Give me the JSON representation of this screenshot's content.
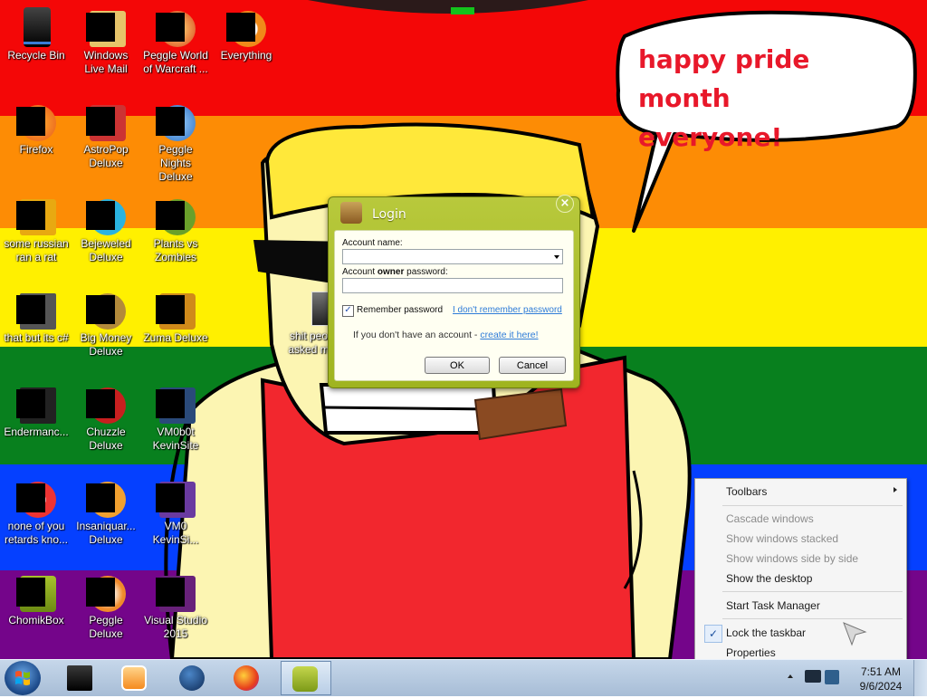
{
  "wallpaper": {
    "colors": [
      "#f40707",
      "#fd8c05",
      "#fff000",
      "#08801e",
      "#0540ff",
      "#74058a"
    ],
    "speech_bubble": [
      "happy pride month",
      "everyone!"
    ]
  },
  "desktop": {
    "icons": [
      {
        "label": "Recycle Bin",
        "icon": "recycle-bin-icon"
      },
      {
        "label": "Windows Live Mail",
        "icon": "mail-icon"
      },
      {
        "label": "Peggle World of Warcraft ...",
        "icon": "peggle-icon"
      },
      {
        "label": "Everything",
        "icon": "everything-search-icon"
      },
      {
        "label": "Firefox",
        "icon": "firefox-icon"
      },
      {
        "label": "AstroPop Deluxe",
        "icon": "astropop-icon"
      },
      {
        "label": "Peggle Nights Deluxe",
        "icon": "peggle-nights-icon"
      },
      {
        "label": "some russian ran a rat",
        "icon": "ie-icon"
      },
      {
        "label": "Bejeweled Deluxe",
        "icon": "bejeweled-icon"
      },
      {
        "label": "Plants vs Zombies",
        "icon": "plants-vs-zombies-icon"
      },
      {
        "label": "that but its c#",
        "icon": "shortcut-icon"
      },
      {
        "label": "Big Money Deluxe",
        "icon": "money-bag-icon"
      },
      {
        "label": "Zuma Deluxe",
        "icon": "zuma-icon"
      },
      {
        "label": "Endermanc...",
        "icon": "window-icon"
      },
      {
        "label": "Chuzzle Deluxe",
        "icon": "chuzzle-icon"
      },
      {
        "label": "VM0b0t KevinSite",
        "icon": "vm-icon"
      },
      {
        "label": "none of you retards kno...",
        "icon": "chrome-icon"
      },
      {
        "label": "Insaniquar... Deluxe",
        "icon": "insaniquarium-icon"
      },
      {
        "label": "VM0 KevinSi...",
        "icon": "vm-icon"
      },
      {
        "label": "ChomikBox",
        "icon": "chomikbox-icon"
      },
      {
        "label": "Peggle Deluxe",
        "icon": "peggle-deluxe-icon"
      },
      {
        "label": "Visual Studio 2015",
        "icon": "visual-studio-icon"
      },
      {
        "label": "shit peo... asked m...",
        "icon": "file-icon"
      }
    ]
  },
  "login_dialog": {
    "title": "Login",
    "account_name_label": "Account name:",
    "account_name_value": "",
    "password_label_pre": "Account ",
    "password_label_bold": "owner",
    "password_label_post": " password:",
    "password_value": "",
    "remember_label": "Remember password",
    "remember_checked": true,
    "forgot_link": "I don't remember password",
    "no_account_text": "If you don't have an account - ",
    "create_link": "create it here!",
    "ok_label": "OK",
    "cancel_label": "Cancel",
    "close_glyph": "×"
  },
  "context_menu": {
    "items": [
      {
        "label": "Toolbars",
        "enabled": true,
        "submenu": true
      },
      {
        "label": "Cascade windows",
        "enabled": false
      },
      {
        "label": "Show windows stacked",
        "enabled": false
      },
      {
        "label": "Show windows side by side",
        "enabled": false
      },
      {
        "label": "Show the desktop",
        "enabled": true
      },
      {
        "label": "Start Task Manager",
        "enabled": true
      },
      {
        "label": "Lock the taskbar",
        "enabled": true,
        "checked": true
      },
      {
        "label": "Properties",
        "enabled": true
      }
    ],
    "check_glyph": "✓"
  },
  "taskbar": {
    "pinned": [
      {
        "name": "black-box-app-icon"
      },
      {
        "name": "media-player-icon"
      },
      {
        "name": "globe-icon"
      },
      {
        "name": "firefox-icon"
      },
      {
        "name": "chomikbox-icon",
        "active": true
      }
    ],
    "clock": {
      "time": "7:51 AM",
      "date": "9/6/2024"
    }
  }
}
